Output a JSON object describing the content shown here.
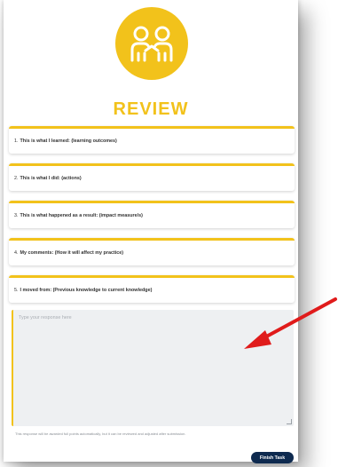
{
  "header": {
    "title": "REVIEW",
    "logo_icon": "two-people-icon",
    "brand_color": "#f2c21b"
  },
  "items": [
    {
      "num": "1.",
      "label": "This is what I learned: (learning outcomes)"
    },
    {
      "num": "2.",
      "label": "This is what I did: (actions)"
    },
    {
      "num": "3.",
      "label": "This is what happened as a result: (impact measure/s)"
    },
    {
      "num": "4.",
      "label": "My comments: (How it will affect my practice)"
    },
    {
      "num": "5.",
      "label": "I moved from: (Previous knowledge to current knowledge)"
    }
  ],
  "response": {
    "placeholder": "Type your response here",
    "value": ""
  },
  "note": "This response will be awarded full points automatically, but it can be reviewed and adjusted after submission.",
  "actions": {
    "finish_label": "Finish Task",
    "finish_color": "#0e2a4f"
  },
  "annotation": {
    "arrow_color": "#e01b1b",
    "arrow_icon": "red-arrow-icon"
  }
}
